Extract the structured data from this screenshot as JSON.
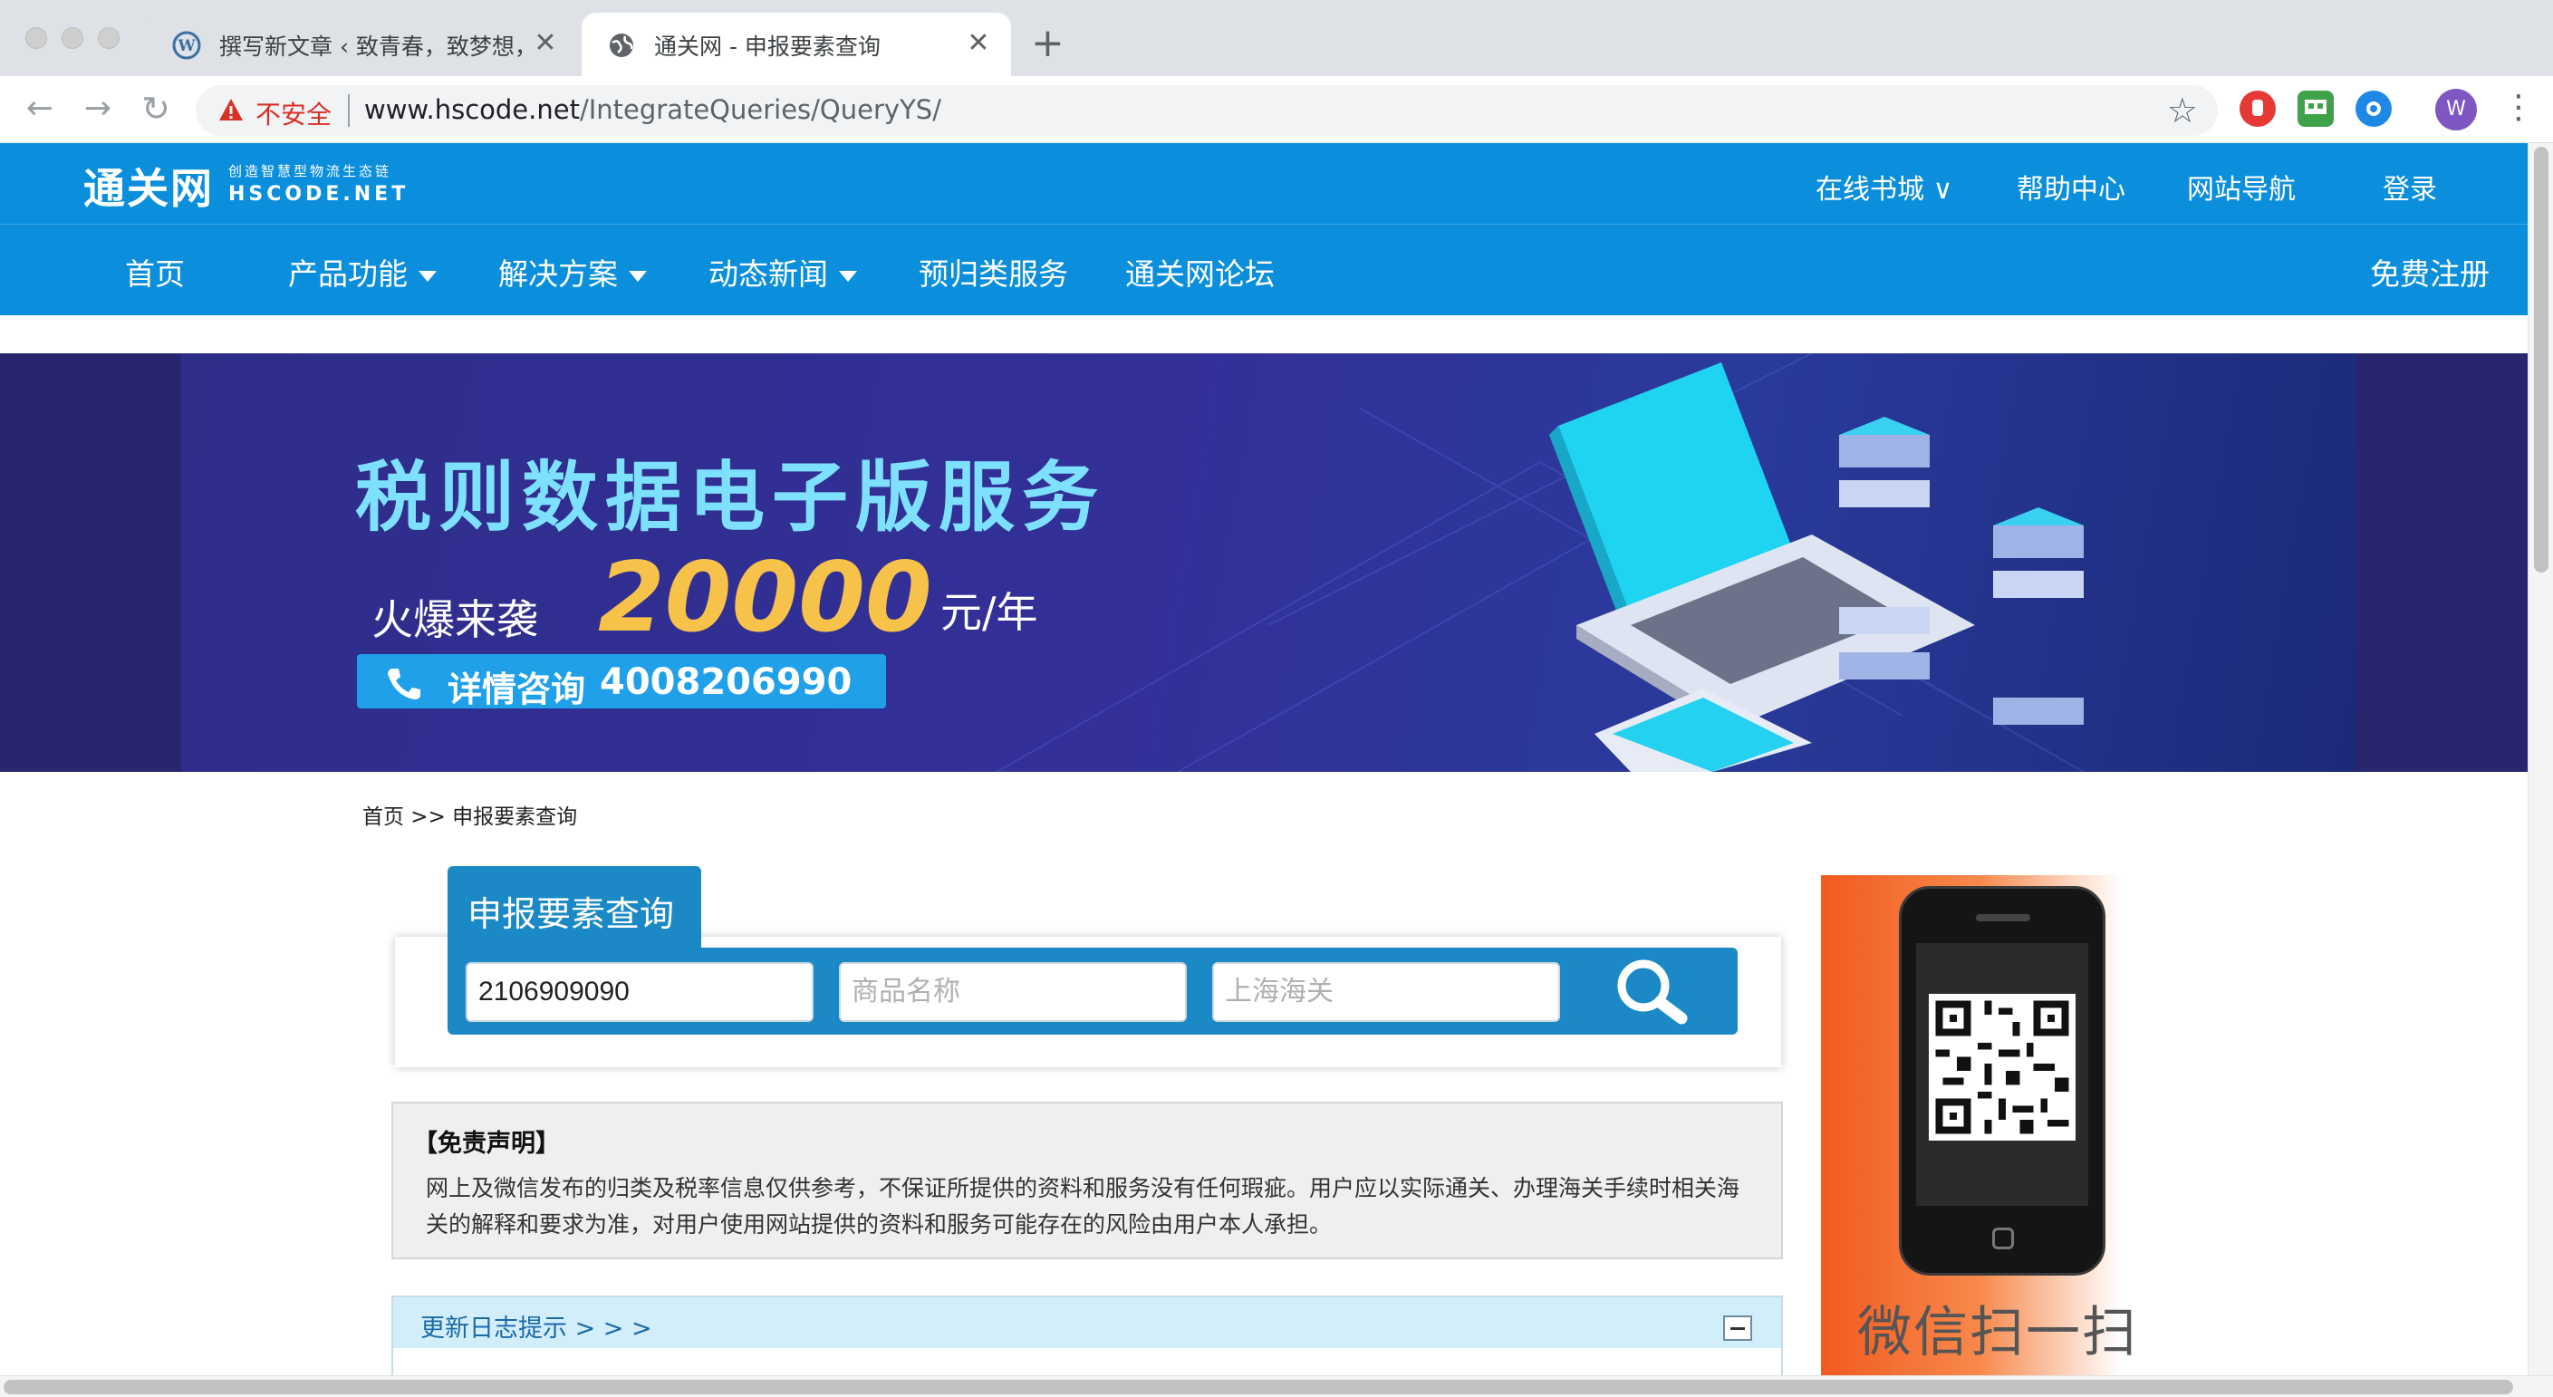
{
  "browser": {
    "tabs": [
      {
        "title": "撰写新文章 ‹ 致青春，致梦想，",
        "icon": "wordpress-icon",
        "active": false
      },
      {
        "title": "通关网 - 申报要素查询",
        "icon": "globe-icon",
        "active": true
      }
    ],
    "new_tab_label": "+",
    "close_glyph": "✕",
    "security_label": "不安全",
    "url_host": "www.hscode.net",
    "url_path": "/IntegrateQueries/QueryYS/",
    "avatar_letter": "W",
    "colors": {
      "accent": "#0b8fdc",
      "insecure": "#d93025",
      "avatar": "#7e57c2"
    }
  },
  "site": {
    "logo_text": "通关网",
    "logo_slogan": "创造智慧型物流生态链",
    "logo_domain": "HSCODE.NET",
    "top_links": [
      "在线书城 ∨",
      "帮助中心",
      "网站导航",
      "登录"
    ],
    "nav": [
      {
        "label": "首页",
        "dropdown": false
      },
      {
        "label": "产品功能",
        "dropdown": true
      },
      {
        "label": "解决方案",
        "dropdown": true
      },
      {
        "label": "动态新闻",
        "dropdown": true
      },
      {
        "label": "预归类服务",
        "dropdown": false
      },
      {
        "label": "通关网论坛",
        "dropdown": false
      }
    ],
    "register_label": "免费注册"
  },
  "banner": {
    "title": "税则数据电子版服务",
    "subtitle": "火爆来袭",
    "price": "20000",
    "unit": "元/年",
    "contact_label": "详情咨询",
    "phone": "4008206990"
  },
  "breadcrumb": {
    "home": "首页",
    "separator": " >> ",
    "current": "申报要素查询"
  },
  "query": {
    "tab_label": "申报要素查询",
    "code_value": "2106909090",
    "name_placeholder": "商品名称",
    "customs_placeholder": "上海海关"
  },
  "disclaimer": {
    "title": "【免责声明】",
    "body": "网上及微信发布的归类及税率信息仅供参考，不保证所提供的资料和服务没有任何瑕疵。用户应以实际通关、办理海关手续时相关海关的解释和要求为准，对用户使用网站提供的资料和服务可能存在的风险由用户本人承担。"
  },
  "update_log": {
    "label": "更新日志提示 > > >"
  },
  "qr_ad": {
    "caption": "微信扫一扫"
  }
}
